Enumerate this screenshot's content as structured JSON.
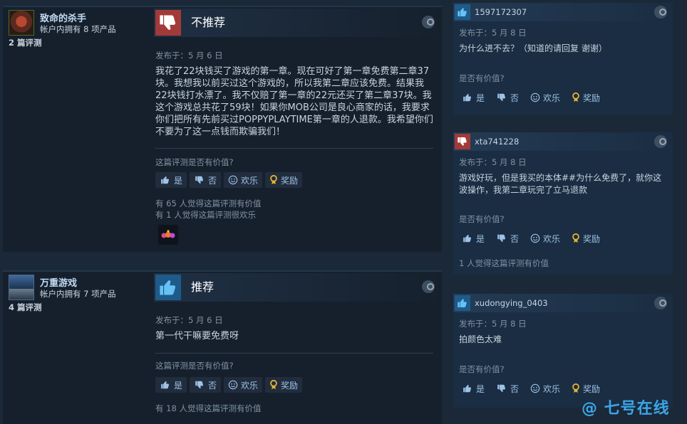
{
  "reviews": [
    {
      "author": {
        "name": "致命的杀手",
        "owned": "帐户内拥有 8 项产品",
        "review_count": "2 篇评测"
      },
      "verdict": "不推荐",
      "posted": "发布于：5 月 6 日",
      "text": "我花了22块钱买了游戏的第一章。现在可好了第一章免费第二章37块。我想我以前买过这个游戏的，所以我第二章应该免费。结果我22块钱打水漂了。我不仅赔了第一章的22元还买了第二章37块。我这个游戏总共花了59块！如果你MOB公司是良心商家的话，我要求你们把所有先前买过POPPYPLAYTIME第一章的人退款。我希望你们不要为了这一点钱而欺骗我们！",
      "helpful_question": "这篇评测是否有价值?",
      "buttons": {
        "yes": "是",
        "no": "否",
        "funny": "欢乐",
        "award": "奖励"
      },
      "stats": [
        "有 65 人觉得这篇评测有价值",
        "有 1 人觉得这篇评测很欢乐"
      ]
    },
    {
      "author": {
        "name": "万重游戏",
        "owned": "帐户内拥有 7 项产品",
        "review_count": "4 篇评测"
      },
      "verdict": "推荐",
      "posted": "发布于：5 月 6 日",
      "text": "第一代干嘛要免费呀",
      "helpful_question": "这篇评测是否有价值?",
      "buttons": {
        "yes": "是",
        "no": "否",
        "funny": "欢乐",
        "award": "奖励"
      },
      "stats": [
        "有 18 人觉得这篇评测有价值"
      ]
    }
  ],
  "comments": [
    {
      "vote": "up",
      "user": "1597172307",
      "posted": "发布于：5 月 8 日",
      "text": "为什么进不去？（知道的请回复 谢谢）",
      "helpful_question": "是否有价值?",
      "buttons": {
        "yes": "是",
        "no": "否",
        "funny": "欢乐",
        "award": "奖励"
      },
      "stat": ""
    },
    {
      "vote": "down",
      "user": "xta741228",
      "posted": "发布于：5 月 8 日",
      "text": "游戏好玩，但是我买的本体##为什么免费了，就你这波操作，我第二章玩完了立马退款",
      "helpful_question": "是否有价值?",
      "buttons": {
        "yes": "是",
        "no": "否",
        "funny": "欢乐",
        "award": "奖励"
      },
      "stat": "1 人觉得这篇评测有价值"
    },
    {
      "vote": "up",
      "user": "xudongying_0403",
      "posted": "发布于：5 月 8 日",
      "text": "拍颜色太难",
      "helpful_question": "是否有价值?",
      "buttons": {
        "yes": "是",
        "no": "否",
        "funny": "欢乐",
        "award": "奖励"
      },
      "stat": ""
    }
  ],
  "watermark": "七号在线",
  "colors": {
    "background": "#1b2838",
    "panel": "#16202d",
    "thumb_up": "#1e5b8a",
    "thumb_down": "#a33a3a",
    "button_text": "#9ec3e6"
  }
}
